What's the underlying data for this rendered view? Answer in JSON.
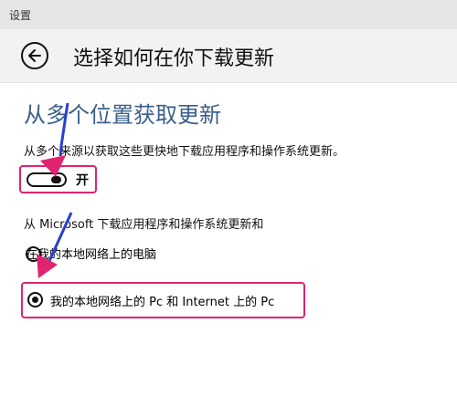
{
  "window": {
    "title": "设置"
  },
  "header": {
    "title": "选择如何在你下载更新"
  },
  "section": {
    "title": "从多个位置获取更新",
    "description": "从多个来源以获取这些更快地下载应用程序和操作系统更新。"
  },
  "toggle": {
    "state_label": "开",
    "on": true
  },
  "download_from": {
    "label": "从 Microsoft 下载应用程序和操作系统更新和",
    "options": [
      {
        "label": "在我的本地网络上的电脑",
        "selected": false
      },
      {
        "label": "我的本地网络上的 Pc 和 Internet 上的 Pc",
        "selected": true
      }
    ]
  },
  "colors": {
    "accent_blue": "#3a5f8a",
    "highlight_pink": "#e0246f",
    "arrow_blue": "#2a3fd0"
  },
  "icons": {
    "back": "back-arrow-circle-icon"
  }
}
